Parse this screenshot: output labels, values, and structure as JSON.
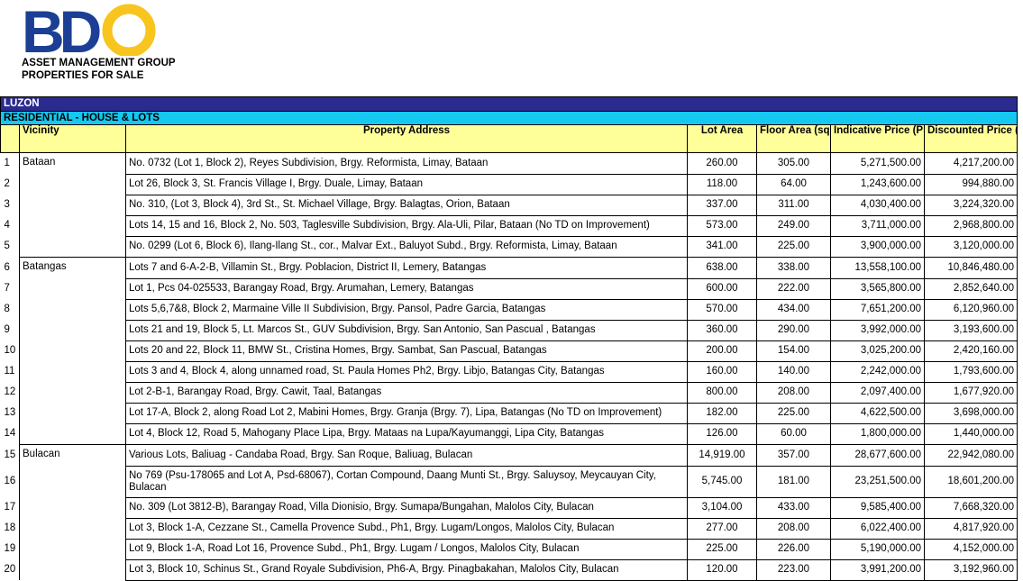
{
  "header": {
    "logo_text": "BDO",
    "org_line1": "ASSET MANAGEMENT GROUP",
    "org_line2": "PROPERTIES FOR SALE"
  },
  "region": "LUZON",
  "category": "RESIDENTIAL  - HOUSE & LOTS",
  "columns": {
    "vicinity": "Vicinity",
    "address": "Property Address",
    "lot_area": "Lot Area",
    "floor_area": "Floor Area (sqms.)",
    "indicative_price": "Indicative Price (Php)",
    "discounted_price": "Discounted Price (Php)"
  },
  "rows": [
    {
      "num": "1",
      "vicinity": "Bataan",
      "address": "No. 0732 (Lot 1, Block 2), Reyes Subdivision, Brgy. Reformista, Limay, Bataan",
      "lot": "260.00",
      "floor": "305.00",
      "indicative": "5,271,500.00",
      "discounted": "4,217,200.00"
    },
    {
      "num": "2",
      "vicinity": "",
      "address": "Lot 26, Block 3, St. Francis Village I, Brgy. Duale, Limay, Bataan",
      "lot": "118.00",
      "floor": "64.00",
      "indicative": "1,243,600.00",
      "discounted": "994,880.00"
    },
    {
      "num": "3",
      "vicinity": "",
      "address": "No. 310, (Lot 3, Block 4), 3rd St.,  St. Michael Village, Brgy. Balagtas, Orion, Bataan",
      "lot": "337.00",
      "floor": "311.00",
      "indicative": "4,030,400.00",
      "discounted": "3,224,320.00"
    },
    {
      "num": "4",
      "vicinity": "",
      "address": "Lots 14, 15 and 16, Block 2, No. 503, Taglesville Subdivision, Brgy. Ala-Uli, Pilar, Bataan (No TD on Improvement)",
      "lot": "573.00",
      "floor": "249.00",
      "indicative": "3,711,000.00",
      "discounted": "2,968,800.00"
    },
    {
      "num": "5",
      "vicinity": "",
      "address": "No. 0299 (Lot 6, Block 6), Ilang-Ilang St., cor., Malvar Ext., Baluyot Subd., Brgy. Reformista, Limay, Bataan",
      "lot": "341.00",
      "floor": "225.00",
      "indicative": "3,900,000.00",
      "discounted": "3,120,000.00"
    },
    {
      "num": "6",
      "vicinity": "Batangas",
      "address": "Lots 7 and 6-A-2-B, Villamin St., Brgy. Poblacion, District II, Lemery, Batangas",
      "lot": "638.00",
      "floor": "338.00",
      "indicative": "13,558,100.00",
      "discounted": "10,846,480.00"
    },
    {
      "num": "7",
      "vicinity": "",
      "address": "Lot 1, Pcs 04-025533, Barangay Road, Brgy. Arumahan, Lemery, Batangas",
      "lot": "600.00",
      "floor": "222.00",
      "indicative": "3,565,800.00",
      "discounted": "2,852,640.00"
    },
    {
      "num": "8",
      "vicinity": "",
      "address": "Lots 5,6,7&8, Block 2, Marmaine Ville II Subdivision, Brgy. Pansol, Padre Garcia, Batangas",
      "lot": "570.00",
      "floor": "434.00",
      "indicative": "7,651,200.00",
      "discounted": "6,120,960.00"
    },
    {
      "num": "9",
      "vicinity": "",
      "address": "Lots 21 and 19, Block 5, Lt. Marcos St., GUV Subdivision, Brgy. San Antonio, San Pascual , Batangas",
      "lot": "360.00",
      "floor": "290.00",
      "indicative": "3,992,000.00",
      "discounted": "3,193,600.00"
    },
    {
      "num": "10",
      "vicinity": "",
      "address": "Lots 20 and 22, Block 11, BMW St., Cristina Homes, Brgy. Sambat, San Pascual, Batangas",
      "lot": "200.00",
      "floor": "154.00",
      "indicative": "3,025,200.00",
      "discounted": "2,420,160.00"
    },
    {
      "num": "11",
      "vicinity": "",
      "address": "Lots 3 and 4, Block 4, along unnamed road, St. Paula Homes Ph2, Brgy. Libjo, Batangas City, Batangas",
      "lot": "160.00",
      "floor": "140.00",
      "indicative": "2,242,000.00",
      "discounted": "1,793,600.00"
    },
    {
      "num": "12",
      "vicinity": "",
      "address": "Lot 2-B-1, Barangay Road, Brgy. Cawit, Taal, Batangas",
      "lot": "800.00",
      "floor": "208.00",
      "indicative": "2,097,400.00",
      "discounted": "1,677,920.00"
    },
    {
      "num": "13",
      "vicinity": "",
      "address": "Lot 17-A, Block 2, along Road Lot 2, Mabini Homes, Brgy. Granja (Brgy. 7), Lipa, Batangas (No TD on Improvement)",
      "lot": "182.00",
      "floor": "225.00",
      "indicative": "4,622,500.00",
      "discounted": "3,698,000.00"
    },
    {
      "num": "14",
      "vicinity": "",
      "address": "Lot 4, Block 12, Road 5, Mahogany Place Lipa, Brgy. Mataas na Lupa/Kayumanggi, Lipa City, Batangas",
      "lot": "126.00",
      "floor": "60.00",
      "indicative": "1,800,000.00",
      "discounted": "1,440,000.00"
    },
    {
      "num": "15",
      "vicinity": "Bulacan",
      "address": "Various Lots, Baliuag - Candaba Road, Brgy. San Roque, Baliuag, Bulacan",
      "lot": "14,919.00",
      "floor": "357.00",
      "indicative": "28,677,600.00",
      "discounted": "22,942,080.00"
    },
    {
      "num": "16",
      "vicinity": "",
      "address": "No 769 (Psu-178065 and Lot A, Psd-68067), Cortan Compound, Daang Munti St., Brgy. Saluysoy, Meycauyan City, Bulacan",
      "lot": "5,745.00",
      "floor": "181.00",
      "indicative": "23,251,500.00",
      "discounted": "18,601,200.00",
      "tall": true
    },
    {
      "num": "17",
      "vicinity": "",
      "address": "No. 309 (Lot 3812-B), Barangay Road, Villa Dionisio, Brgy. Sumapa/Bungahan, Malolos City, Bulacan",
      "lot": "3,104.00",
      "floor": "433.00",
      "indicative": "9,585,400.00",
      "discounted": "7,668,320.00"
    },
    {
      "num": "18",
      "vicinity": "",
      "address": "Lot 3, Block 1-A, Cezzane St., Camella Provence Subd., Ph1, Brgy. Lugam/Longos, Malolos City, Bulacan",
      "lot": "277.00",
      "floor": "208.00",
      "indicative": "6,022,400.00",
      "discounted": "4,817,920.00"
    },
    {
      "num": "19",
      "vicinity": "",
      "address": "Lot 9, Block 1-A, Road Lot 16, Provence Subd., Ph1, Brgy. Lugam / Longos, Malolos City, Bulacan",
      "lot": "225.00",
      "floor": "226.00",
      "indicative": "5,190,000.00",
      "discounted": "4,152,000.00"
    },
    {
      "num": "20",
      "vicinity": "",
      "address": "Lot 3, Block 10, Schinus St., Grand Royale Subdivision, Ph6-A, Brgy. Pinagbakahan, Malolos City, Bulacan",
      "lot": "120.00",
      "floor": "223.00",
      "indicative": "3,991,200.00",
      "discounted": "3,192,960.00"
    }
  ]
}
